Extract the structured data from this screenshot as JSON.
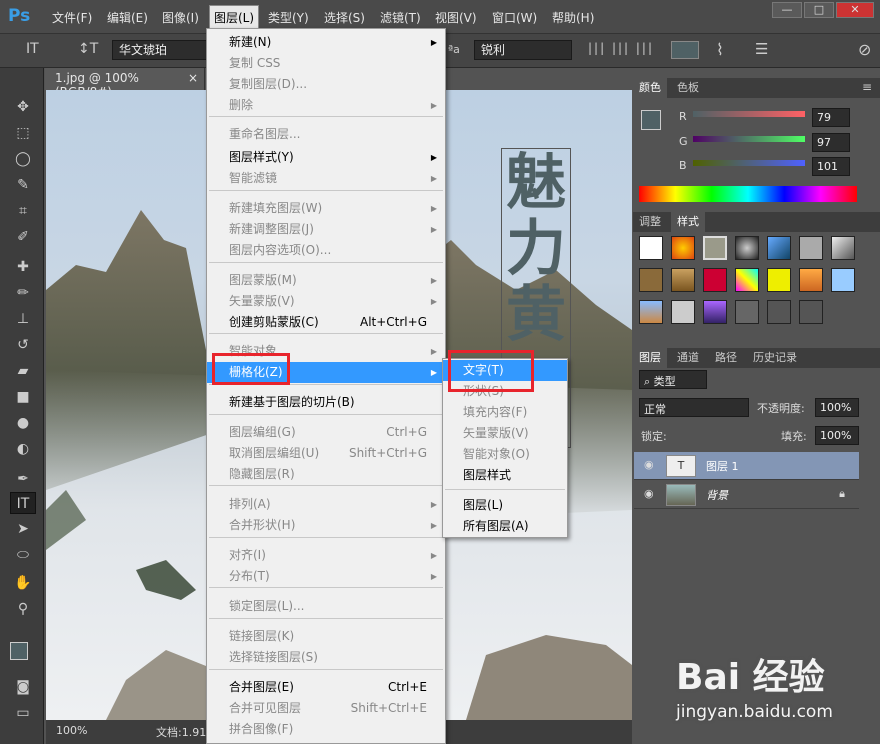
{
  "app": {
    "logo": "Ps"
  },
  "menubar": {
    "items": [
      "文件(F)",
      "编辑(E)",
      "图像(I)",
      "图层(L)",
      "类型(Y)",
      "选择(S)",
      "滤镜(T)",
      "视图(V)",
      "窗口(W)",
      "帮助(H)"
    ]
  },
  "window_controls": {
    "minimize": "—",
    "maximize": "□",
    "close": "✕"
  },
  "options_bar": {
    "font": "华文琥珀",
    "antialias": "锐利",
    "aa_label": "ªa"
  },
  "document": {
    "tab": "1.jpg @ 100%(RGB/8#)",
    "close": "×",
    "zoom": "100%",
    "doc_info": "文档:1.91"
  },
  "canvas_text": [
    "魅",
    "力",
    "黄"
  ],
  "layer_menu": {
    "items": [
      {
        "label": "新建(N)",
        "enabled": true,
        "submenu": true
      },
      {
        "label": "复制 CSS",
        "enabled": false
      },
      {
        "label": "复制图层(D)...",
        "enabled": false
      },
      {
        "label": "删除",
        "enabled": false,
        "submenu": true
      },
      {
        "label": "重命名图层...",
        "enabled": false
      },
      {
        "label": "图层样式(Y)",
        "enabled": true,
        "submenu": true
      },
      {
        "label": "智能滤镜",
        "enabled": false,
        "submenu": true
      },
      {
        "label": "新建填充图层(W)",
        "enabled": false,
        "submenu": true
      },
      {
        "label": "新建调整图层(J)",
        "enabled": false,
        "submenu": true
      },
      {
        "label": "图层内容选项(O)...",
        "enabled": false
      },
      {
        "label": "图层蒙版(M)",
        "enabled": false,
        "submenu": true
      },
      {
        "label": "矢量蒙版(V)",
        "enabled": false,
        "submenu": true
      },
      {
        "label": "创建剪贴蒙版(C)",
        "enabled": true,
        "shortcut": "Alt+Ctrl+G"
      },
      {
        "label": "智能对象",
        "enabled": false,
        "submenu": true
      },
      {
        "label": "栅格化(Z)",
        "enabled": true,
        "submenu": true,
        "highlighted": true
      },
      {
        "label": "新建基于图层的切片(B)",
        "enabled": true
      },
      {
        "label": "图层编组(G)",
        "enabled": false,
        "shortcut": "Ctrl+G"
      },
      {
        "label": "取消图层编组(U)",
        "enabled": false,
        "shortcut": "Shift+Ctrl+G"
      },
      {
        "label": "隐藏图层(R)",
        "enabled": false
      },
      {
        "label": "排列(A)",
        "enabled": false,
        "submenu": true
      },
      {
        "label": "合并形状(H)",
        "enabled": false,
        "submenu": true
      },
      {
        "label": "对齐(I)",
        "enabled": false,
        "submenu": true
      },
      {
        "label": "分布(T)",
        "enabled": false,
        "submenu": true
      },
      {
        "label": "锁定图层(L)...",
        "enabled": false
      },
      {
        "label": "链接图层(K)",
        "enabled": false
      },
      {
        "label": "选择链接图层(S)",
        "enabled": false
      },
      {
        "label": "合并图层(E)",
        "enabled": true,
        "shortcut": "Ctrl+E"
      },
      {
        "label": "合并可见图层",
        "enabled": false,
        "shortcut": "Shift+Ctrl+E"
      },
      {
        "label": "拼合图像(F)",
        "enabled": false
      }
    ]
  },
  "rasterize_submenu": {
    "items": [
      {
        "label": "文字(T)",
        "enabled": true,
        "highlighted": true
      },
      {
        "label": "形状(S)",
        "enabled": false
      },
      {
        "label": "填充内容(F)",
        "enabled": false
      },
      {
        "label": "矢量蒙版(V)",
        "enabled": false
      },
      {
        "label": "智能对象(O)",
        "enabled": false
      },
      {
        "label": "图层样式",
        "enabled": true
      },
      {
        "label": "图层(L)",
        "enabled": true
      },
      {
        "label": "所有图层(A)",
        "enabled": true
      }
    ]
  },
  "color_panel": {
    "tabs": [
      "颜色",
      "色板"
    ],
    "channels": [
      {
        "name": "R",
        "value": "79",
        "level": 0.31
      },
      {
        "name": "G",
        "value": "97",
        "level": 0.38
      },
      {
        "name": "B",
        "value": "101",
        "level": 0.4
      }
    ],
    "fg_color": "#4f6165",
    "bg_color": "#ffffff"
  },
  "styles_panel": {
    "tabs": [
      "调整",
      "样式"
    ]
  },
  "layers_panel": {
    "tabs": [
      "图层",
      "通道",
      "路径",
      "历史记录"
    ],
    "filter": "类型",
    "blend": "正常",
    "opacity_label": "不透明度:",
    "opacity": "100%",
    "lock_label": "锁定:",
    "fill_label": "填充:",
    "fill": "100%",
    "layers": [
      {
        "name": "图层 1",
        "thumb": "T",
        "selected": true
      },
      {
        "name": "背景",
        "thumb": "",
        "selected": false,
        "locked": true
      }
    ]
  },
  "watermark": {
    "text": "Bai 经验",
    "url": "jingyan.baidu.com"
  }
}
